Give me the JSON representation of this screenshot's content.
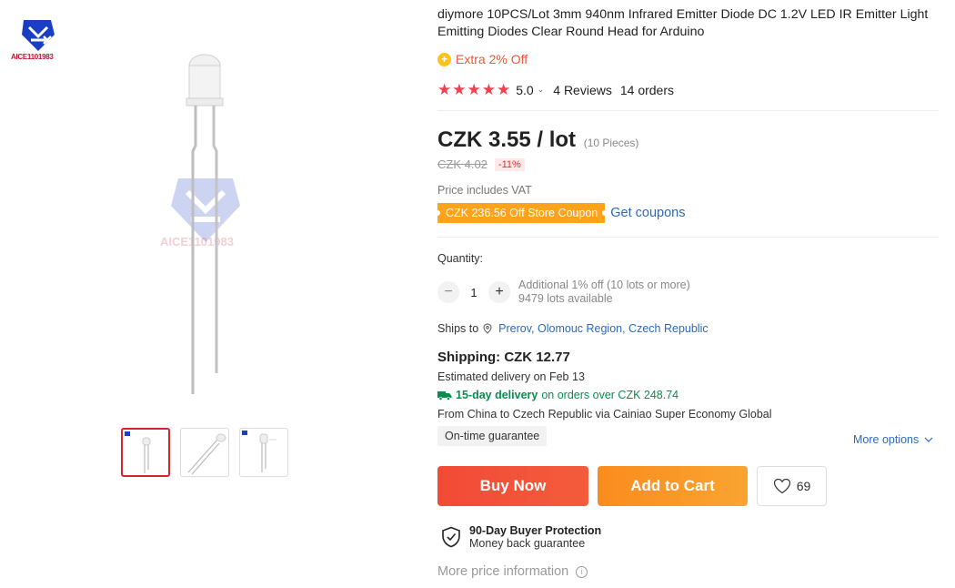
{
  "brand": {
    "logo_text": "AICE1101983"
  },
  "product": {
    "title": "diymore 10PCS/Lot 3mm 940nm Infrared Emitter Diode DC 1.2V LED IR Emitter Light Emitting Diodes Clear Round Head for Arduino",
    "extra_discount": "Extra 2% Off",
    "rating": {
      "score": "5.0",
      "stars": 5,
      "reviews": "4 Reviews",
      "orders": "14 orders"
    },
    "price": "CZK 3.55 / lot",
    "pieces": "(10 Pieces)",
    "old_price": "CZK 4.02",
    "discount": "-11%",
    "vat_note": "Price includes VAT",
    "coupon": "CZK 236.56 Off Store Coupon",
    "get_coupons": "Get coupons"
  },
  "quantity": {
    "label": "Quantity:",
    "value": "1",
    "additional": "Additional 1% off (10 lots or more)",
    "available": "9479 lots available"
  },
  "shipping": {
    "ships_to_label": "Ships to",
    "ships_to_location": "Prerov, Olomouc Region, Czech Republic",
    "cost": "Shipping: CZK 12.77",
    "estimated": "Estimated delivery on Feb 13",
    "fast_bold": "15-day delivery",
    "fast_rest": "on orders over CZK 248.74",
    "route": "From China to Czech Republic via Cainiao Super Economy Global",
    "ontime": "On-time guarantee",
    "more_options": "More options"
  },
  "actions": {
    "buy_now": "Buy Now",
    "add_to_cart": "Add to Cart",
    "wishlist_count": "69"
  },
  "protection": {
    "title": "90-Day Buyer Protection",
    "subtitle": "Money back guarantee"
  },
  "more_price_info": "More price information",
  "colors": {
    "buy": "#f24a36",
    "cart": "#fb8c1d",
    "coupon": "#ffa31a",
    "star": "#f0414f",
    "link": "#2d6ab6",
    "delivery": "#0a8c4f"
  }
}
